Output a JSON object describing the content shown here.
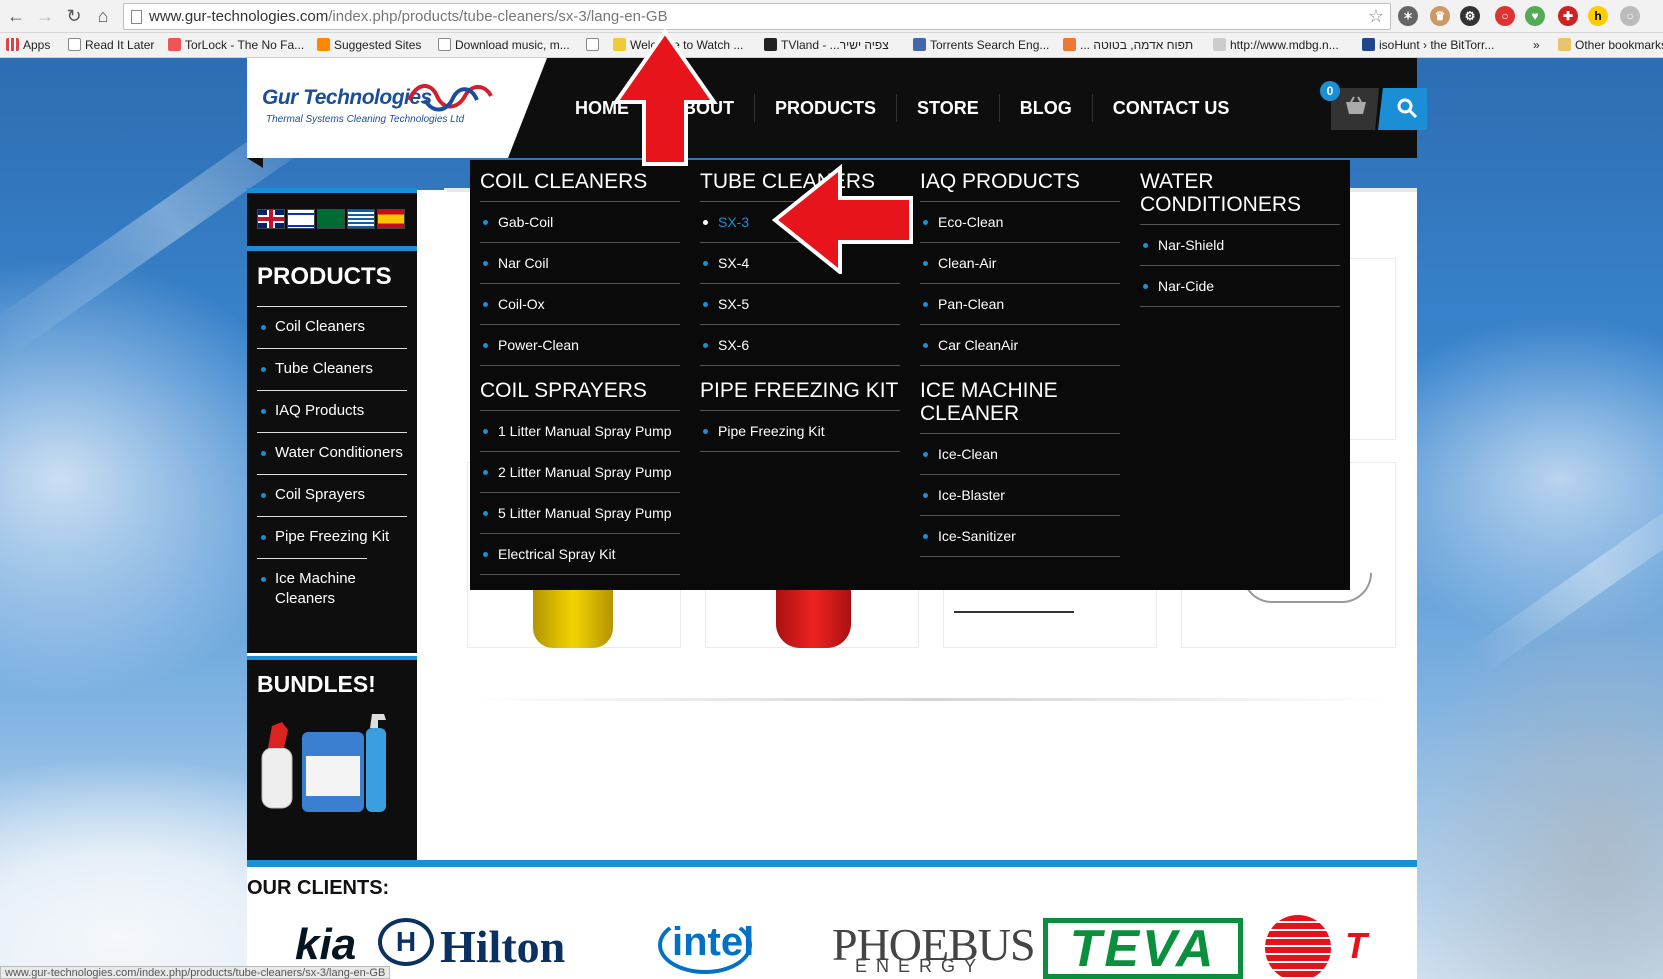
{
  "browser": {
    "url_main": "www.gur-technologies.com",
    "url_path": "/index.php/products/tube-cleaners/sx-3/lang-en-GB",
    "bookmarks": [
      "Apps",
      "Read It Later",
      "TorLock - The No Fa...",
      "Suggested Sites",
      "Download music, m...",
      "",
      "Welcome to Watch ...",
      "TVland - ...צפיה ישיר",
      "Torrents Search Eng...",
      "... תפוח אדמה, בטוטה",
      "http://www.mdbg.n...",
      "isoHunt › the BitTorr...",
      "»",
      "Other bookmarks"
    ],
    "status_url": "www.gur-technologies.com/index.php/products/tube-cleaners/sx-3/lang-en-GB"
  },
  "site": {
    "logo_name": "Gur Technologies",
    "logo_tagline": "Thermal Systems Cleaning Technologies Ltd",
    "nav": [
      "HOME",
      "ABOUT",
      "PRODUCTS",
      "STORE",
      "BLOG",
      "CONTACT US"
    ],
    "cart_count": "0",
    "brand_blue": "#1a8fd6"
  },
  "sidebar": {
    "title": "PRODUCTS",
    "items": [
      "Coil Cleaners",
      "Tube Cleaners",
      "IAQ Products",
      "Water Conditioners",
      "Coil Sprayers",
      "Pipe Freezing Kit",
      "Ice Machine Cleaners"
    ],
    "bundles_title": "BUNDLES!",
    "languages": [
      "en",
      "he",
      "ar",
      "el",
      "es"
    ]
  },
  "mega_menu": {
    "col1": {
      "title": "COIL CLEANERS",
      "items": [
        "Gab-Coil",
        "Nar Coil",
        "Coil-Ox",
        "Power-Clean"
      ],
      "title2": "COIL SPRAYERS",
      "items2": [
        "1 Litter Manual Spray Pump",
        "2 Litter Manual Spray Pump",
        "5 Litter Manual Spray Pump",
        "Electrical Spray Kit"
      ]
    },
    "col2": {
      "title": "TUBE CLEANERS",
      "items": [
        "SX-3",
        "SX-4",
        "SX-5",
        "SX-6"
      ],
      "title2": "PIPE FREEZING KIT",
      "items2": [
        "Pipe Freezing Kit"
      ]
    },
    "col3": {
      "title": "IAQ PRODUCTS",
      "items": [
        "Eco-Clean",
        "Clean-Air",
        "Pan-Clean",
        "Car CleanAir"
      ],
      "title2": "ICE MACHINE CLEANER",
      "items2": [
        "Ice-Clean",
        "Ice-Blaster",
        "Ice-Sanitizer"
      ]
    },
    "col4": {
      "title": "WATER CONDITIONERS",
      "items": [
        "Nar-Shield",
        "Nar-Cide"
      ]
    }
  },
  "clients": {
    "title": "OUR CLIENTS:",
    "logos": [
      "kia",
      "Hilton",
      "intel",
      "PHOEBUS",
      "ENERGY",
      "TEVA",
      "T"
    ]
  }
}
